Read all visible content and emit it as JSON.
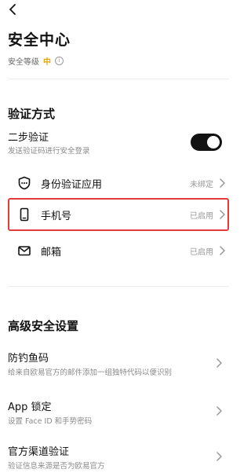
{
  "header": {
    "title": "安全中心",
    "level_label": "安全等级",
    "level_value": "中",
    "info_glyph": "i"
  },
  "verification": {
    "section_title": "验证方式",
    "two_step": {
      "title": "二步验证",
      "subtitle": "发送验证码进行安全登录",
      "enabled": true
    },
    "methods": [
      {
        "label": "身份验证应用",
        "status": "未绑定",
        "icon": "shield-dots-icon"
      },
      {
        "label": "手机号",
        "status": "已启用",
        "icon": "phone-icon",
        "highlighted": true
      },
      {
        "label": "邮箱",
        "status": "已启用",
        "icon": "mail-icon"
      }
    ]
  },
  "advanced": {
    "section_title": "高级安全设置",
    "items": [
      {
        "title": "防钓鱼码",
        "subtitle": "给来自欧易官方的邮件添加一组独特代码以便识别"
      },
      {
        "title": "App 锁定",
        "subtitle": "设置 Face ID 和手势密码"
      },
      {
        "title": "官方渠道验证",
        "subtitle": "验证信息来源是否为欧易官方"
      }
    ]
  },
  "colors": {
    "accent_level": "#e6a700",
    "highlight_border": "#e23b3b",
    "toggle_on": "#121212"
  }
}
